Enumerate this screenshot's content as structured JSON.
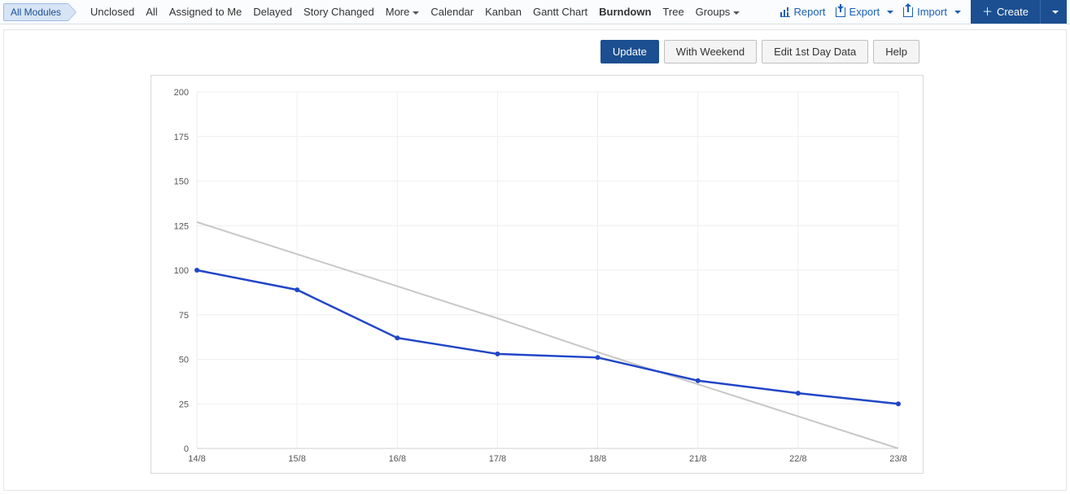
{
  "toolbar": {
    "module_pill": "All Modules",
    "tabs": [
      {
        "label": "Unclosed"
      },
      {
        "label": "All"
      },
      {
        "label": "Assigned to Me"
      },
      {
        "label": "Delayed"
      },
      {
        "label": "Story Changed"
      },
      {
        "label": "More",
        "dropdown": true
      },
      {
        "label": "Calendar"
      },
      {
        "label": "Kanban"
      },
      {
        "label": "Gantt Chart"
      },
      {
        "label": "Burndown",
        "active": true
      },
      {
        "label": "Tree"
      },
      {
        "label": "Groups",
        "dropdown": true
      }
    ],
    "report": "Report",
    "export": "Export",
    "import": "Import",
    "create": "Create"
  },
  "chart_toolbar": {
    "update": "Update",
    "with_weekend": "With Weekend",
    "edit_first_day": "Edit 1st Day Data",
    "help": "Help"
  },
  "chart_data": {
    "type": "line",
    "title": "",
    "xlabel": "",
    "ylabel": "",
    "ylim": [
      0,
      200
    ],
    "yticks": [
      0,
      25,
      50,
      75,
      100,
      125,
      150,
      175,
      200
    ],
    "categories": [
      "14/8",
      "15/8",
      "16/8",
      "17/8",
      "18/8",
      "21/8",
      "22/8",
      "23/8"
    ],
    "series": [
      {
        "name": "Ideal",
        "color": "#c7c7c7",
        "values": [
          127,
          109,
          91,
          73,
          54,
          36,
          18,
          0
        ]
      },
      {
        "name": "Actual",
        "color": "#2046c7",
        "values": [
          100,
          89,
          62,
          53,
          51,
          38,
          31,
          25
        ]
      }
    ]
  }
}
